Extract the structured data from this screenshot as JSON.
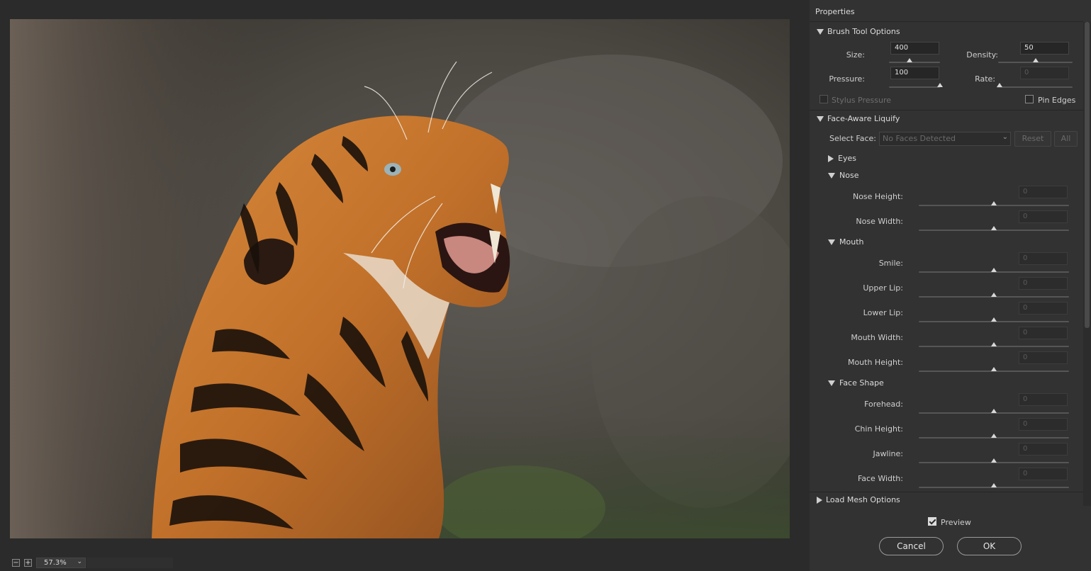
{
  "panel": {
    "title": "Properties",
    "brush": {
      "header": "Brush Tool Options",
      "size_label": "Size:",
      "size_value": "400",
      "size_level": 0.4,
      "density_label": "Density:",
      "density_value": "50",
      "density_level": 0.5,
      "pressure_label": "Pressure:",
      "pressure_value": "100",
      "pressure_level": 1.0,
      "rate_label": "Rate:",
      "rate_value": "0",
      "rate_level": 0.0,
      "stylus_label": "Stylus Pressure",
      "stylus_checked": false,
      "pin_label": "Pin Edges",
      "pin_checked": false
    },
    "face": {
      "header": "Face-Aware Liquify",
      "select_label": "Select Face:",
      "select_value": "No Faces Detected",
      "reset_label": "Reset",
      "all_label": "All",
      "eyes_label": "Eyes",
      "nose": {
        "label": "Nose",
        "items": [
          {
            "label": "Nose Height:",
            "value": "0"
          },
          {
            "label": "Nose Width:",
            "value": "0"
          }
        ]
      },
      "mouth": {
        "label": "Mouth",
        "items": [
          {
            "label": "Smile:",
            "value": "0"
          },
          {
            "label": "Upper Lip:",
            "value": "0"
          },
          {
            "label": "Lower Lip:",
            "value": "0"
          },
          {
            "label": "Mouth Width:",
            "value": "0"
          },
          {
            "label": "Mouth Height:",
            "value": "0"
          }
        ]
      },
      "shape": {
        "label": "Face Shape",
        "items": [
          {
            "label": "Forehead:",
            "value": "0"
          },
          {
            "label": "Chin Height:",
            "value": "0"
          },
          {
            "label": "Jawline:",
            "value": "0"
          },
          {
            "label": "Face Width:",
            "value": "0"
          }
        ]
      }
    },
    "mesh_header": "Load Mesh Options",
    "preview_label": "Preview",
    "preview_checked": true,
    "cancel_label": "Cancel",
    "ok_label": "OK"
  },
  "canvas": {
    "zoom_value": "57.3%",
    "zoom_out_icon": "minus-icon",
    "zoom_in_icon": "plus-icon"
  },
  "colors": {
    "panel_bg": "#323232",
    "app_bg": "#2b2b2b",
    "field_bg": "#262626"
  }
}
